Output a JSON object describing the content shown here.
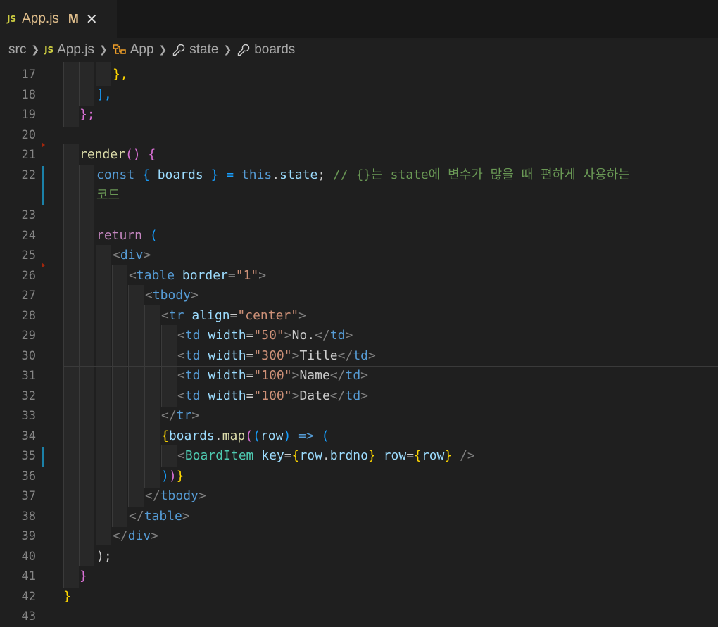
{
  "tab": {
    "badge": "JS",
    "title": "App.js",
    "status": "M",
    "close": "✕"
  },
  "breadcrumb": {
    "items": [
      {
        "label": "src",
        "icon": "folder"
      },
      {
        "label": "App.js",
        "icon": "js-file-icon",
        "badge": "JS"
      },
      {
        "label": "App",
        "icon": "class-icon"
      },
      {
        "label": "state",
        "icon": "property-wrench-icon"
      },
      {
        "label": "boards",
        "icon": "property-wrench-icon"
      }
    ],
    "separator": "❯"
  },
  "editor": {
    "line_numbers": [
      "17",
      "18",
      "19",
      "20",
      "21",
      "22",
      "",
      "23",
      "24",
      "25",
      "26",
      "27",
      "28",
      "29",
      "30",
      "31",
      "32",
      "33",
      "34",
      "35",
      "36",
      "37",
      "38",
      "39",
      "40",
      "41",
      "42",
      "43"
    ],
    "lines": {
      "l17": "},",
      "l18": "],",
      "l19": "};",
      "l21a": "render",
      "l21b": "() {",
      "l22_const": "const",
      "l22_a": " { ",
      "l22_boards": "boards",
      "l22_b": " } = ",
      "l22_this": "this",
      "l22_dot": ".",
      "l22_state": "state",
      "l22_semi": "; ",
      "l22_comment": "// {}는 state에 변수가 많을 때 편하게 사용하는",
      "l22_wrap": "코드",
      "l24_return": "return",
      "l24_paren": " (",
      "l25": "div",
      "l26_tag": "table",
      "l26_attr": "border",
      "l26_val": "\"1\"",
      "l27": "tbody",
      "l28_tag": "tr",
      "l28_attr": "align",
      "l28_val": "\"center\"",
      "td_tag": "td",
      "td_attr": "width",
      "l29_val": "\"50\"",
      "l29_text": "No.",
      "l30_val": "\"300\"",
      "l30_text": "Title",
      "l31_val": "\"100\"",
      "l31_text": "Name",
      "l32_val": "\"100\"",
      "l32_text": "Date",
      "l33": "tr",
      "l34_boards": "boards",
      "l34_map": "map",
      "l34_row": "row",
      "l34_arrow": "=>",
      "l35_comp": "BoardItem",
      "l35_key": "key",
      "l35_row": "row",
      "l35_brdno": "brdno",
      "l35_rowattr": "row",
      "l37": "tbody",
      "l38": "table",
      "l39": "div",
      "l40": ");",
      "l41": "}",
      "l42": "}"
    }
  },
  "colors": {
    "background": "#1f1f1f",
    "tab_title": "#e2c08d",
    "js_badge": "#cbcb41",
    "gutter_modified": "#1b81a8"
  }
}
